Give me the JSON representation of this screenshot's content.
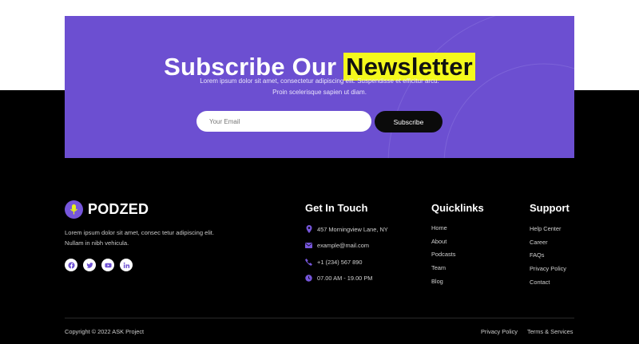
{
  "newsletter": {
    "title_main": "Subscribe Our ",
    "title_highlight": "Newsletter",
    "description_line1": "Lorem ipsum dolor sit amet, consectetur adipiscing elit. Suspendisse et efficitur arcu.",
    "description_line2": "Proin scelerisque sapien ut diam.",
    "email_placeholder": "Your Email",
    "email_value": "",
    "subscribe_label": "Subscribe"
  },
  "brand": {
    "name": "PODZED",
    "description": "Lorem ipsum dolor sit amet, consec tetur adipiscing elit. Nullam in nibh vehicula.",
    "socials": [
      "facebook-icon",
      "twitter-icon",
      "youtube-icon",
      "linkedin-icon"
    ]
  },
  "contact": {
    "title": "Get In Touch",
    "items": [
      {
        "icon": "location-pin-icon",
        "text": "457 Morningview Lane, NY"
      },
      {
        "icon": "envelope-icon",
        "text": "example@mail.com"
      },
      {
        "icon": "phone-icon",
        "text": "+1 (234) 567 890"
      },
      {
        "icon": "clock-icon",
        "text": "07.00 AM - 19.00 PM"
      }
    ]
  },
  "quicklinks": {
    "title": "Quicklinks",
    "items": [
      "Home",
      "About",
      "Podcasts",
      "Team",
      "Blog"
    ]
  },
  "support": {
    "title": "Support",
    "items": [
      "Help Center",
      "Career",
      "FAQs",
      "Privacy Policy",
      "Contact"
    ]
  },
  "bottom": {
    "copyright": "Copyright © 2022 ASK Project",
    "privacy": "Privacy Policy",
    "terms": "Terms & Services"
  },
  "colors": {
    "accent": "#6c4fd1",
    "highlight": "#f4f91c",
    "background": "#000000"
  }
}
